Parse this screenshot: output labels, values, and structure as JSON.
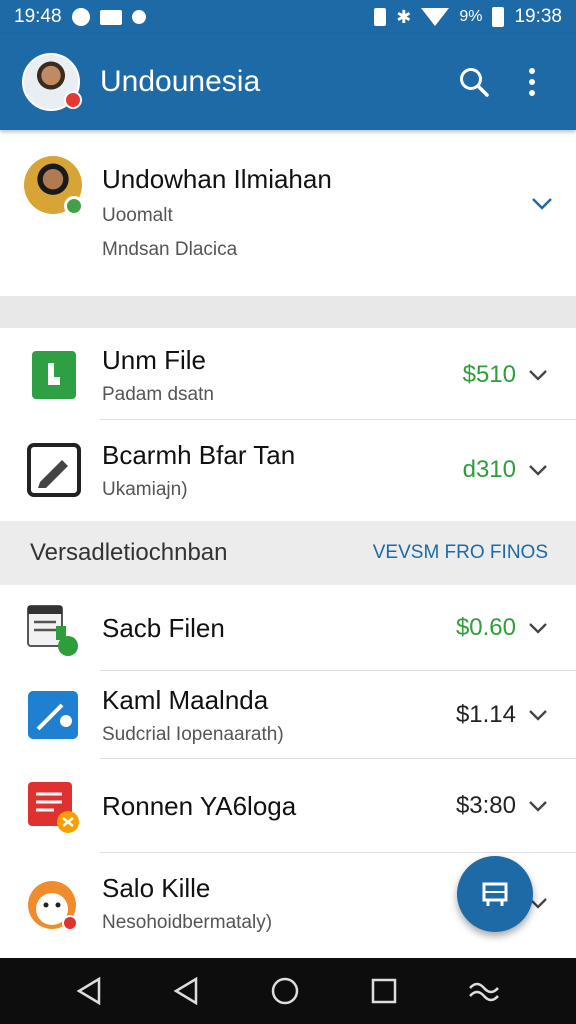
{
  "status_bar": {
    "time_left": "19:48",
    "battery": "9%",
    "time_right": "19:38"
  },
  "app_bar": {
    "title": "Undounesia"
  },
  "account": {
    "name": "Undowhan Ilmiahan",
    "subtitle": "Uoomalt",
    "detail": "Mndsan Dlacica"
  },
  "accounts_list": [
    {
      "title": "Unm File",
      "subtitle": "Padam dsatn",
      "amount": "$510",
      "icon": "green-document-icon"
    },
    {
      "title": "Bcarmh Bfar Tan",
      "subtitle": "Ukamiajn)",
      "amount": "d310",
      "icon": "pencil-icon"
    }
  ],
  "section": {
    "title": "Versadletiochnban",
    "action": "VEVSM FRO FINOS"
  },
  "transactions": [
    {
      "title": "Sacb Filen",
      "subtitle": "",
      "amount": "$0.60",
      "amount_color": "#2e9d3a",
      "icon": "notepad-icon"
    },
    {
      "title": "Kaml Maalnda",
      "subtitle": "Sudcrial Iopenaarath)",
      "amount": "$1.14",
      "amount_color": "#222222",
      "icon": "blue-pen-icon"
    },
    {
      "title": "Ronnen YA6loga",
      "subtitle": "",
      "amount": "$3:80",
      "amount_color": "#222222",
      "icon": "red-document-icon"
    },
    {
      "title": "Salo Kille",
      "subtitle": "Nesohoidbermataly)",
      "amount": "",
      "amount_color": "#222222",
      "icon": "chick-icon"
    }
  ],
  "colors": {
    "primary": "#1d6aa6",
    "positive": "#2e9d3a"
  }
}
